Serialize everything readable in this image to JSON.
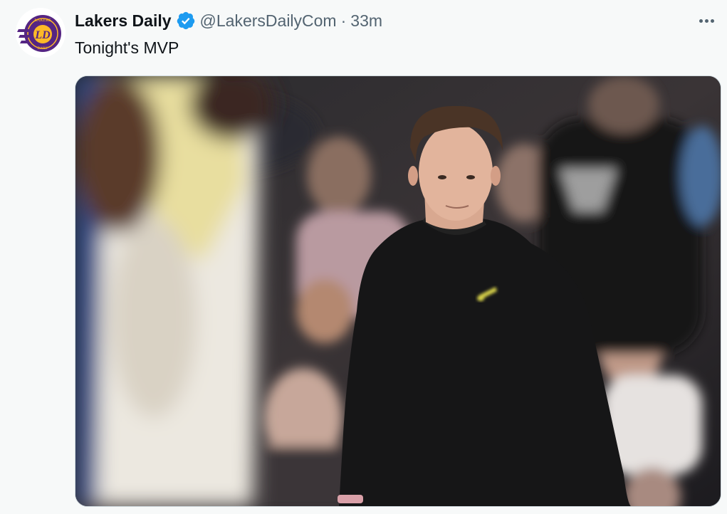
{
  "author": {
    "display_name": "Lakers Daily",
    "handle": "@LakersDailyCom",
    "separator": "·",
    "time": "33m",
    "avatar_logo_text": "LD",
    "avatar_ring_text_top": "LAKERS",
    "avatar_ring_text_bottom": "DAILY"
  },
  "tweet": {
    "text": "Tonight's MVP"
  },
  "media": {
    "description_icon": "photo-icon"
  },
  "colors": {
    "verified_blue": "#1d9bf0",
    "lakers_purple": "#552583",
    "lakers_gold": "#fdb927",
    "text_primary": "#0f1419",
    "text_secondary": "#536471"
  },
  "icons": {
    "verified": "verified-badge-icon",
    "more": "more-options-icon"
  }
}
